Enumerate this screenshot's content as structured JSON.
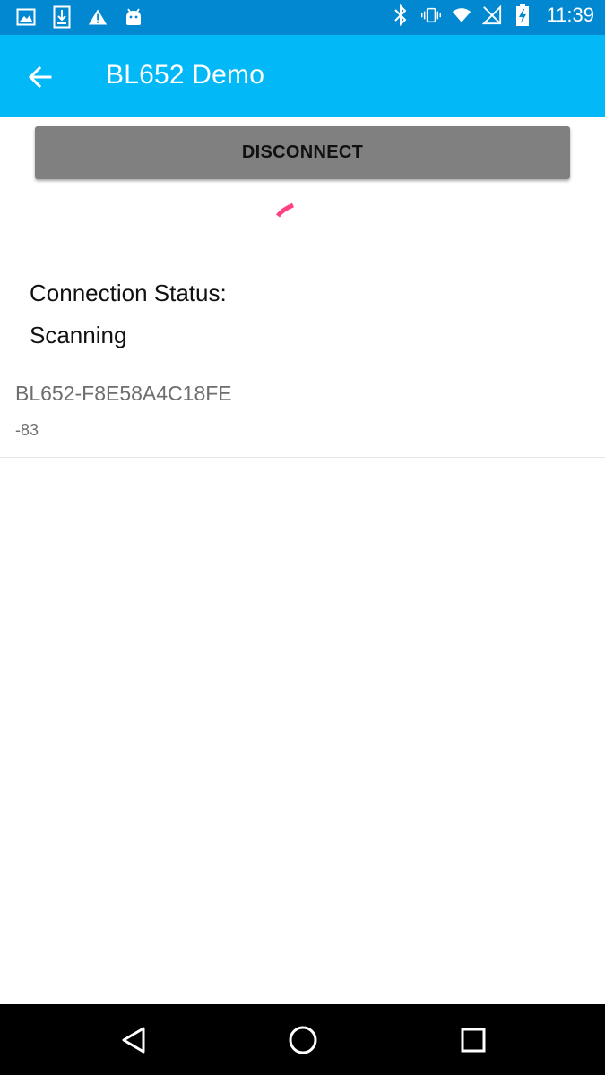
{
  "status_bar": {
    "time": "11:39",
    "left_icons": [
      "image-icon",
      "download-icon",
      "warning-icon",
      "android-icon"
    ],
    "right_icons": [
      "bluetooth-icon",
      "vibrate-icon",
      "wifi-icon",
      "no-signal-icon",
      "battery-charging-icon"
    ]
  },
  "app_bar": {
    "title": "BL652 Demo",
    "back_icon": "arrow-back-icon",
    "color": "#03b8f6"
  },
  "actions": {
    "disconnect_label": "DISCONNECT"
  },
  "connection": {
    "label": "Connection Status:",
    "value": "Scanning"
  },
  "devices": [
    {
      "name": "BL652-F8E58A4C18FE",
      "rssi": "-83"
    }
  ],
  "nav_bar": {
    "buttons": [
      "back-triangle-icon",
      "home-circle-icon",
      "recents-square-icon"
    ]
  },
  "colors": {
    "status_bar": "#0288d1",
    "accent_spinner": "#ff4081",
    "button_bg": "#808080"
  }
}
